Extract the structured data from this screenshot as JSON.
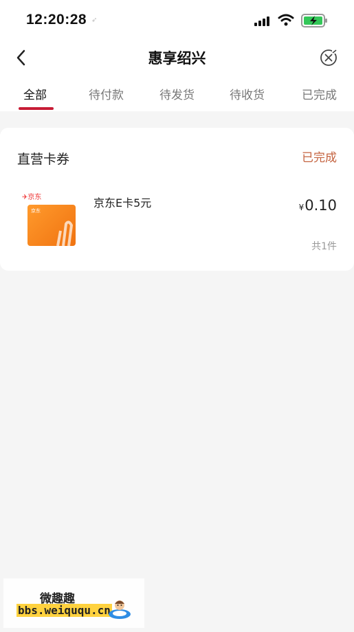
{
  "status_bar": {
    "time": "12:20:28"
  },
  "nav": {
    "title": "惠享绍兴"
  },
  "tabs": [
    "全部",
    "待付款",
    "待发货",
    "待收货",
    "已完成"
  ],
  "order": {
    "category": "直营卡券",
    "status": "已完成",
    "item": {
      "logo_text": "京东",
      "card_text": "京东",
      "name": "京东E卡5元",
      "currency": "¥",
      "price": "0.10",
      "quantity": "共1件"
    }
  },
  "watermark": {
    "line1": "微趣趣",
    "line2": "bbs.weiququ.cn"
  },
  "colors": {
    "accent": "#c71c35",
    "status": "#c4623f",
    "card": "#f58220"
  }
}
